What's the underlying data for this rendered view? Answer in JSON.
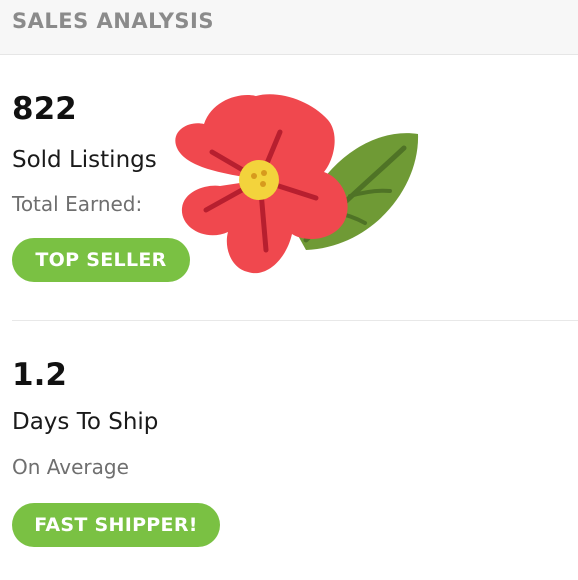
{
  "header": {
    "title": "SALES ANALYSIS"
  },
  "stats": [
    {
      "value": "822",
      "label": "Sold Listings",
      "sub": "Total Earned:",
      "badge": "TOP SELLER"
    },
    {
      "value": "1.2",
      "label": "Days To Ship",
      "sub": "On Average",
      "badge": "FAST SHIPPER!"
    }
  ],
  "sticker": {
    "icon": "hibiscus-flower-icon",
    "petal_color": "#f0484e",
    "leaf_color": "#6f9a35",
    "center_color": "#f3d33c"
  },
  "colors": {
    "badge_green": "#7ac143",
    "header_text": "#8b8b8b"
  }
}
